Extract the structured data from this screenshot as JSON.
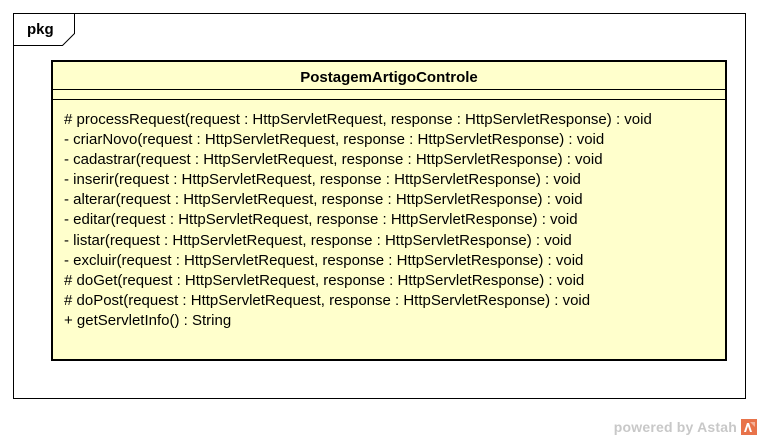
{
  "package": {
    "label": "pkg"
  },
  "class": {
    "name": "PostagemArtigoControle",
    "fill_color": "#FFFFCC",
    "operations": [
      "# processRequest(request : HttpServletRequest, response : HttpServletResponse) : void",
      "- criarNovo(request : HttpServletRequest, response : HttpServletResponse) : void",
      "- cadastrar(request : HttpServletRequest, response : HttpServletResponse) : void",
      "- inserir(request : HttpServletRequest, response : HttpServletResponse) : void",
      "- alterar(request : HttpServletRequest, response : HttpServletResponse) : void",
      "- editar(request : HttpServletRequest, response : HttpServletResponse) : void",
      "- listar(request : HttpServletRequest, response : HttpServletResponse) : void",
      "- excluir(request : HttpServletRequest, response : HttpServletResponse) : void",
      "# doGet(request : HttpServletRequest, response : HttpServletResponse) : void",
      "# doPost(request : HttpServletRequest, response : HttpServletResponse) : void",
      "+ getServletInfo() : String"
    ]
  },
  "footer": {
    "powered_by": "powered by Astah",
    "logo_icon": "astah-logo-icon",
    "logo_color": "#E8734A"
  }
}
